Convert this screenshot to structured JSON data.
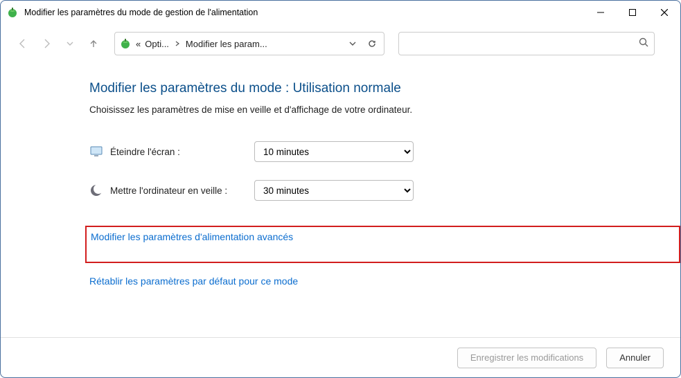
{
  "window": {
    "title": "Modifier les paramètres du mode de gestion de l'alimentation"
  },
  "breadcrumb": {
    "prefix": "«",
    "item1": "Opti...",
    "item2": "Modifier les param..."
  },
  "search": {
    "placeholder": ""
  },
  "heading": "Modifier les paramètres du mode : Utilisation normale",
  "subheading": "Choisissez les paramètres de mise en veille et d'affichage de votre ordinateur.",
  "settings": {
    "display_off": {
      "label": "Éteindre l'écran :",
      "value": "10 minutes"
    },
    "sleep": {
      "label": "Mettre l'ordinateur en veille :",
      "value": "30 minutes"
    }
  },
  "links": {
    "advanced": "Modifier les paramètres d'alimentation avancés",
    "reset": "Rétablir les paramètres par défaut pour ce mode"
  },
  "buttons": {
    "save": "Enregistrer les modifications",
    "cancel": "Annuler"
  }
}
